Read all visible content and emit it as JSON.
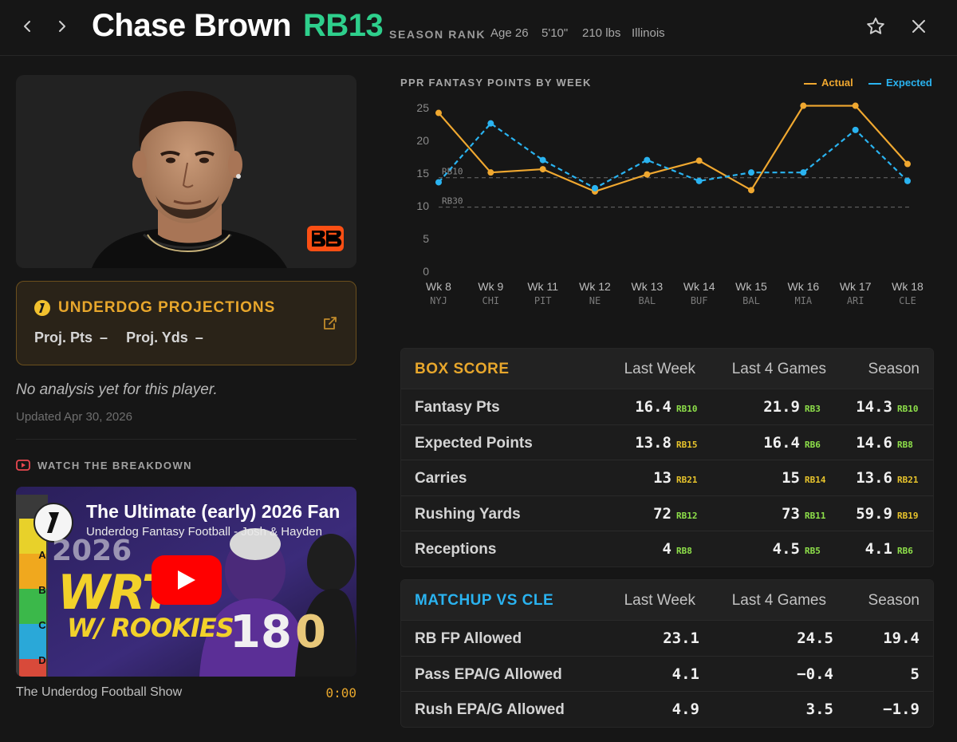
{
  "header": {
    "player_name": "Chase Brown",
    "rank": "RB13",
    "season_rank_label": "SEASON RANK",
    "age": "Age 26",
    "height": "5'10\"",
    "weight": "210 lbs",
    "college": "Illinois"
  },
  "projections": {
    "title": "UNDERDOG PROJECTIONS",
    "pts_label": "Proj. Pts",
    "pts_value": "–",
    "yds_label": "Proj. Yds",
    "yds_value": "–"
  },
  "analysis": {
    "text": "No analysis yet for this player.",
    "updated": "Updated Apr 30, 2026"
  },
  "video": {
    "section_label": "WATCH THE BREAKDOWN",
    "title": "The Ultimate (early) 2026 Fan",
    "channel": "Underdog Fantasy Football - Josh & Hayden",
    "overlay_big": "WRT",
    "overlay_sub": "W/ ROOKIES",
    "overlay_year": "2026",
    "jersey_left": "18",
    "jersey_right": "0",
    "tiers": [
      "A",
      "B",
      "C",
      "D"
    ],
    "caption": "The Underdog Football Show",
    "time": "0:00"
  },
  "chart_data": {
    "type": "line",
    "title": "PPR FANTASY POINTS BY WEEK",
    "categories": [
      "Wk 8",
      "Wk 9",
      "Wk 11",
      "Wk 12",
      "Wk 13",
      "Wk 14",
      "Wk 15",
      "Wk 16",
      "Wk 17",
      "Wk 18"
    ],
    "opponents": [
      "NYJ",
      "CHI",
      "PIT",
      "NE",
      "BAL",
      "BUF",
      "BAL",
      "MIA",
      "ARI",
      "CLE"
    ],
    "series": [
      {
        "name": "Actual",
        "color": "#f0a830",
        "values": [
          24.2,
          15.1,
          15.6,
          12.2,
          14.8,
          16.9,
          12.4,
          25.3,
          25.3,
          16.4
        ]
      },
      {
        "name": "Expected",
        "color": "#2ab3f0",
        "values": [
          13.6,
          22.6,
          17.0,
          12.7,
          17.0,
          13.8,
          15.1,
          15.1,
          21.6,
          13.8
        ]
      }
    ],
    "reference_lines": [
      {
        "label": "RB10",
        "value": 14.3
      },
      {
        "label": "RB30",
        "value": 9.8
      }
    ],
    "ylim": [
      0,
      25
    ],
    "yticks": [
      0,
      5,
      10,
      15,
      20,
      25
    ]
  },
  "box_score": {
    "title": "BOX SCORE",
    "columns": [
      "Last Week",
      "Last 4 Games",
      "Season"
    ],
    "rows": [
      {
        "label": "Fantasy Pts",
        "cells": [
          {
            "v": "16.4",
            "r": "RB10"
          },
          {
            "v": "21.9",
            "r": "RB3"
          },
          {
            "v": "14.3",
            "r": "RB10"
          }
        ]
      },
      {
        "label": "Expected Points",
        "cells": [
          {
            "v": "13.8",
            "r": "RB15"
          },
          {
            "v": "16.4",
            "r": "RB6"
          },
          {
            "v": "14.6",
            "r": "RB8"
          }
        ]
      },
      {
        "label": "Carries",
        "cells": [
          {
            "v": "13",
            "r": "RB21"
          },
          {
            "v": "15",
            "r": "RB14"
          },
          {
            "v": "13.6",
            "r": "RB21"
          }
        ]
      },
      {
        "label": "Rushing Yards",
        "cells": [
          {
            "v": "72",
            "r": "RB12"
          },
          {
            "v": "73",
            "r": "RB11"
          },
          {
            "v": "59.9",
            "r": "RB19"
          }
        ]
      },
      {
        "label": "Receptions",
        "cells": [
          {
            "v": "4",
            "r": "RB8"
          },
          {
            "v": "4.5",
            "r": "RB5"
          },
          {
            "v": "4.1",
            "r": "RB6"
          }
        ]
      }
    ]
  },
  "matchup": {
    "title": "MATCHUP VS CLE",
    "columns": [
      "Last Week",
      "Last 4 Games",
      "Season"
    ],
    "rows": [
      {
        "label": "RB FP Allowed",
        "cells": [
          "23.1",
          "24.5",
          "19.4"
        ]
      },
      {
        "label": "Pass EPA/G Allowed",
        "cells": [
          "4.1",
          "−0.4",
          "5"
        ]
      },
      {
        "label": "Rush EPA/G Allowed",
        "cells": [
          "4.9",
          "3.5",
          "−1.9"
        ]
      }
    ]
  },
  "colors": {
    "accent_green": "#2ecf8c",
    "accent_orange": "#e8a72c",
    "accent_blue": "#2ab3f0",
    "rank_green": "#8ee04a",
    "rank_yellow": "#e8c42c"
  }
}
